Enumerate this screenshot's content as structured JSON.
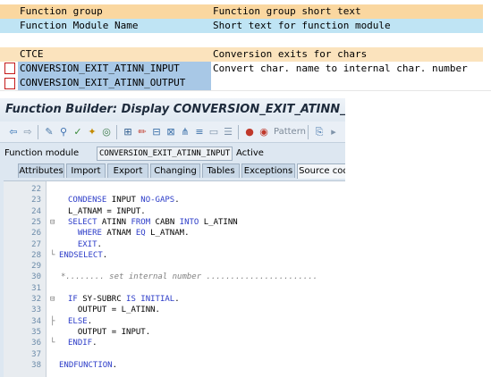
{
  "list": {
    "header1": {
      "col1": "Function group",
      "col2": "Function group short text"
    },
    "header2": {
      "col1": "Function Module Name",
      "col2": "Short text for function module"
    },
    "group": {
      "col1": "CTCE",
      "col2": "Conversion exits for chars"
    },
    "items": [
      {
        "name": "CONVERSION_EXIT_ATINN_INPUT",
        "text": "Convert char. name to internal char. number"
      },
      {
        "name": "CONVERSION_EXIT_ATINN_OUTPUT",
        "text": ""
      }
    ]
  },
  "builder": {
    "title": "Function Builder: Display CONVERSION_EXIT_ATINN_INPUT",
    "toolbar": {
      "pattern_label": "Pattern"
    },
    "fm_label": "Function module",
    "fm_value": "CONVERSION_EXIT_ATINN_INPUT",
    "fm_status": "Active",
    "tabs": [
      "Attributes",
      "Import",
      "Export",
      "Changing",
      "Tables",
      "Exceptions",
      "Source code"
    ],
    "active_tab": "Source code",
    "lines": [
      {
        "n": "22",
        "t": ""
      },
      {
        "n": "23",
        "t": "CONDENSE INPUT NO-GAPS."
      },
      {
        "n": "24",
        "t": "L_ATNAM = INPUT."
      },
      {
        "n": "25",
        "t": "SELECT ATINN FROM CABN INTO L_ATINN"
      },
      {
        "n": "26",
        "t": "  WHERE ATNAM EQ L_ATNAM."
      },
      {
        "n": "27",
        "t": "  EXIT."
      },
      {
        "n": "28",
        "t": "ENDSELECT."
      },
      {
        "n": "29",
        "t": ""
      },
      {
        "n": "30",
        "t": "*........ set internal number ......................."
      },
      {
        "n": "31",
        "t": ""
      },
      {
        "n": "32",
        "t": "IF SY-SUBRC IS INITIAL."
      },
      {
        "n": "33",
        "t": "  OUTPUT = L_ATINN."
      },
      {
        "n": "34",
        "t": "ELSE."
      },
      {
        "n": "35",
        "t": "  OUTPUT = INPUT."
      },
      {
        "n": "36",
        "t": "ENDIF."
      },
      {
        "n": "37",
        "t": ""
      },
      {
        "n": "38",
        "t": "ENDFUNCTION."
      }
    ]
  }
}
